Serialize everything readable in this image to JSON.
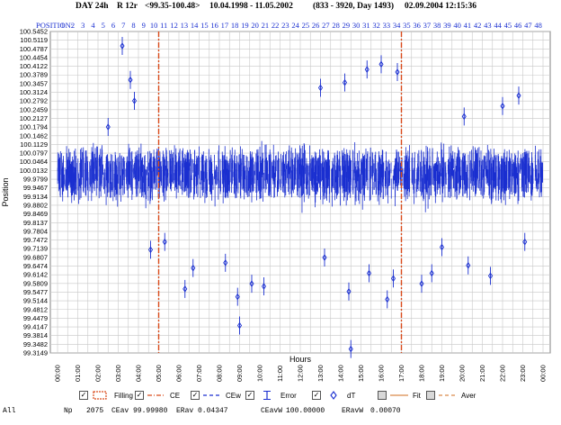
{
  "header": {
    "title": "DAY 24h",
    "mode": "R  12r",
    "range": "<99.35-100.48>",
    "dates": "10.04.1998 - 11.05.2002",
    "count": "(833 - 3920, Day 1493)",
    "timestamp": "02.09.2004   12:15:36"
  },
  "positions": {
    "label": "POSITION:",
    "items": [
      "1",
      "2",
      "3",
      "4",
      "5",
      "6",
      "7",
      "8",
      "9",
      "10",
      "11",
      "12",
      "13",
      "14",
      "15",
      "16",
      "17",
      "18",
      "19",
      "20",
      "21",
      "22",
      "23",
      "24",
      "25",
      "26",
      "27",
      "28",
      "29",
      "30",
      "31",
      "32",
      "33",
      "34",
      "35",
      "36",
      "37",
      "38",
      "39",
      "40",
      "41",
      "42",
      "43",
      "44",
      "45",
      "46",
      "47",
      "48"
    ]
  },
  "chart_data": {
    "type": "scatter",
    "title": "",
    "xlabel": "Hours",
    "ylabel": "Position",
    "x_ticks": [
      "00:00",
      "01:00",
      "02:00",
      "03:00",
      "04:00",
      "05:00",
      "06:00",
      "07:00",
      "08:00",
      "09:00",
      "10:00",
      "11:00",
      "12:00",
      "13:00",
      "14:00",
      "15:00",
      "16:00",
      "17:00",
      "18:00",
      "19:00",
      "20:00",
      "21:00",
      "22:00",
      "23:00",
      "00:00"
    ],
    "y_ticks": [
      "100.5452",
      "100.5119",
      "100.4787",
      "100.4454",
      "100.4122",
      "100.3789",
      "100.3457",
      "100.3124",
      "100.2792",
      "100.2459",
      "100.2127",
      "100.1794",
      "100.1462",
      "100.1129",
      "100.0797",
      "100.0464",
      "100.0132",
      "99.9799",
      "99.9467",
      "99.9134",
      "99.8802",
      "99.8469",
      "99.8137",
      "99.7804",
      "99.7472",
      "99.7139",
      "99.6807",
      "99.6474",
      "99.6142",
      "99.5809",
      "99.5477",
      "99.5144",
      "99.4812",
      "99.4479",
      "99.4147",
      "99.3814",
      "99.3482",
      "99.3149"
    ],
    "x_range": [
      0,
      24
    ],
    "ylim": [
      99.3149,
      100.5452
    ],
    "grid": true,
    "vertical_markers": [
      {
        "x": 5.0,
        "label": "CE"
      },
      {
        "x": 17.0,
        "label": "CE"
      }
    ],
    "series": [
      {
        "name": "Error",
        "color": "#0000dd"
      },
      {
        "name": "dT",
        "color": "#0000dd"
      }
    ],
    "description_of_data": "Dense cloud of ~2075 points with error bars across 24 hours, centered near 100.00 with spread roughly 99.85-100.15 and scattered outliers",
    "outliers": [
      {
        "x": 3.2,
        "y": 100.49
      },
      {
        "x": 3.6,
        "y": 100.36
      },
      {
        "x": 3.8,
        "y": 100.28
      },
      {
        "x": 2.5,
        "y": 100.18
      },
      {
        "x": 4.6,
        "y": 99.71
      },
      {
        "x": 5.3,
        "y": 99.74
      },
      {
        "x": 6.3,
        "y": 99.56
      },
      {
        "x": 6.7,
        "y": 99.64
      },
      {
        "x": 8.3,
        "y": 99.66
      },
      {
        "x": 8.9,
        "y": 99.53
      },
      {
        "x": 9.0,
        "y": 99.42
      },
      {
        "x": 9.6,
        "y": 99.58
      },
      {
        "x": 10.2,
        "y": 99.57
      },
      {
        "x": 13.0,
        "y": 100.33
      },
      {
        "x": 13.2,
        "y": 99.68
      },
      {
        "x": 14.2,
        "y": 100.35
      },
      {
        "x": 14.4,
        "y": 99.55
      },
      {
        "x": 14.5,
        "y": 99.33
      },
      {
        "x": 15.3,
        "y": 100.4
      },
      {
        "x": 15.4,
        "y": 99.62
      },
      {
        "x": 16.0,
        "y": 100.42
      },
      {
        "x": 16.3,
        "y": 99.52
      },
      {
        "x": 16.6,
        "y": 99.6
      },
      {
        "x": 16.8,
        "y": 100.39
      },
      {
        "x": 18.0,
        "y": 99.58
      },
      {
        "x": 18.5,
        "y": 99.62
      },
      {
        "x": 19.0,
        "y": 99.72
      },
      {
        "x": 20.1,
        "y": 100.22
      },
      {
        "x": 20.3,
        "y": 99.65
      },
      {
        "x": 21.4,
        "y": 99.61
      },
      {
        "x": 22.0,
        "y": 100.26
      },
      {
        "x": 22.8,
        "y": 100.3
      },
      {
        "x": 23.1,
        "y": 99.74
      }
    ]
  },
  "legend": {
    "items": [
      {
        "label": "Filling",
        "checked": true,
        "kind": "box",
        "color": "#d94a1a"
      },
      {
        "label": "CE",
        "checked": true,
        "kind": "dashdot",
        "color": "#d94a1a"
      },
      {
        "label": "CEw",
        "checked": true,
        "kind": "dash",
        "color": "#1a2fd0"
      },
      {
        "label": "Error",
        "checked": true,
        "kind": "errorbar",
        "color": "#1a2fd0"
      },
      {
        "label": "dT",
        "checked": true,
        "kind": "diamond",
        "color": "#1a2fd0"
      },
      {
        "label": "Fit",
        "checked": false,
        "kind": "line",
        "color": "#d98a4a"
      },
      {
        "label": "Aver",
        "checked": false,
        "kind": "dash",
        "color": "#d98a4a"
      }
    ]
  },
  "footer": {
    "scope": "All",
    "np_label": "Np",
    "np_value": "2075",
    "ceav_label": "CEav",
    "ceav_value": "99.99980",
    "erav_label": "ERav",
    "erav_value": "0.04347",
    "ceavw_label": "CEavW",
    "ceavw_value": "100.00000",
    "eravw_label": "ERavW",
    "eravw_value": "0.00070"
  },
  "colors": {
    "data": "#1a2fd0",
    "marker": "#d94a1a",
    "grid": "#c8c8c8"
  }
}
